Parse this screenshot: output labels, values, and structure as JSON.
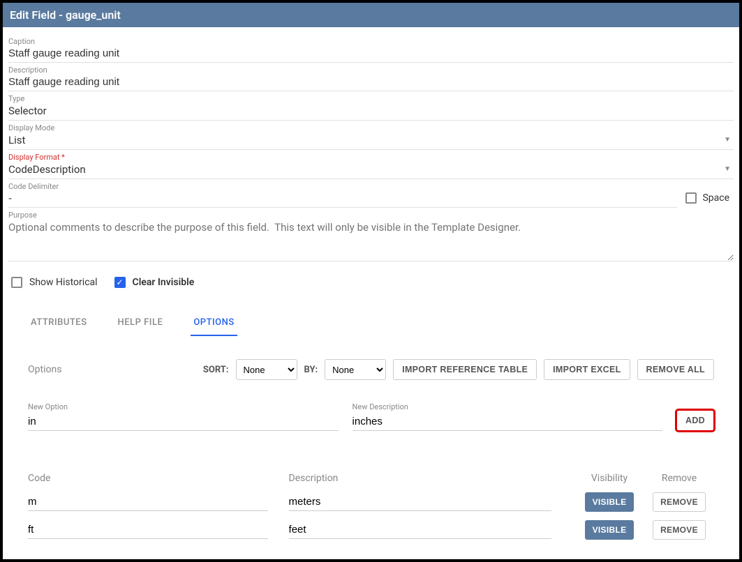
{
  "header": {
    "title": "Edit Field - gauge_unit"
  },
  "fields": {
    "caption": {
      "label": "Caption",
      "value": "Staff gauge reading unit"
    },
    "description": {
      "label": "Description",
      "value": "Staff gauge reading unit"
    },
    "type": {
      "label": "Type",
      "value": "Selector"
    },
    "display_mode": {
      "label": "Display Mode",
      "value": "List"
    },
    "display_format": {
      "label": "Display Format *",
      "value": "CodeDescription"
    },
    "code_delimiter": {
      "label": "Code Delimiter",
      "value": "-"
    },
    "space": {
      "label": "Space",
      "checked": false
    },
    "purpose": {
      "label": "Purpose",
      "placeholder": "Optional comments to describe the purpose of this field.  This text will only be visible in the Template Designer."
    }
  },
  "checks": {
    "show_historical": {
      "label": "Show Historical",
      "checked": false
    },
    "clear_invisible": {
      "label": "Clear Invisible",
      "checked": true
    }
  },
  "tabs": {
    "attributes": "ATTRIBUTES",
    "help_file": "HELP FILE",
    "options": "OPTIONS",
    "active": "options"
  },
  "options": {
    "section_label": "Options",
    "sort_label": "SORT:",
    "sort_value": "None",
    "by_label": "BY:",
    "by_value": "None",
    "import_ref_btn": "IMPORT REFERENCE TABLE",
    "import_excel_btn": "IMPORT EXCEL",
    "remove_all_btn": "REMOVE ALL",
    "new_option_label": "New Option",
    "new_option_value": "in",
    "new_desc_label": "New Description",
    "new_desc_value": "inches",
    "add_btn": "ADD",
    "columns": {
      "code": "Code",
      "description": "Description",
      "visibility": "Visibility",
      "remove": "Remove"
    },
    "visible_btn": "VISIBLE",
    "remove_btn": "REMOVE",
    "rows": [
      {
        "code": "m",
        "description": "meters"
      },
      {
        "code": "ft",
        "description": "feet"
      }
    ]
  }
}
